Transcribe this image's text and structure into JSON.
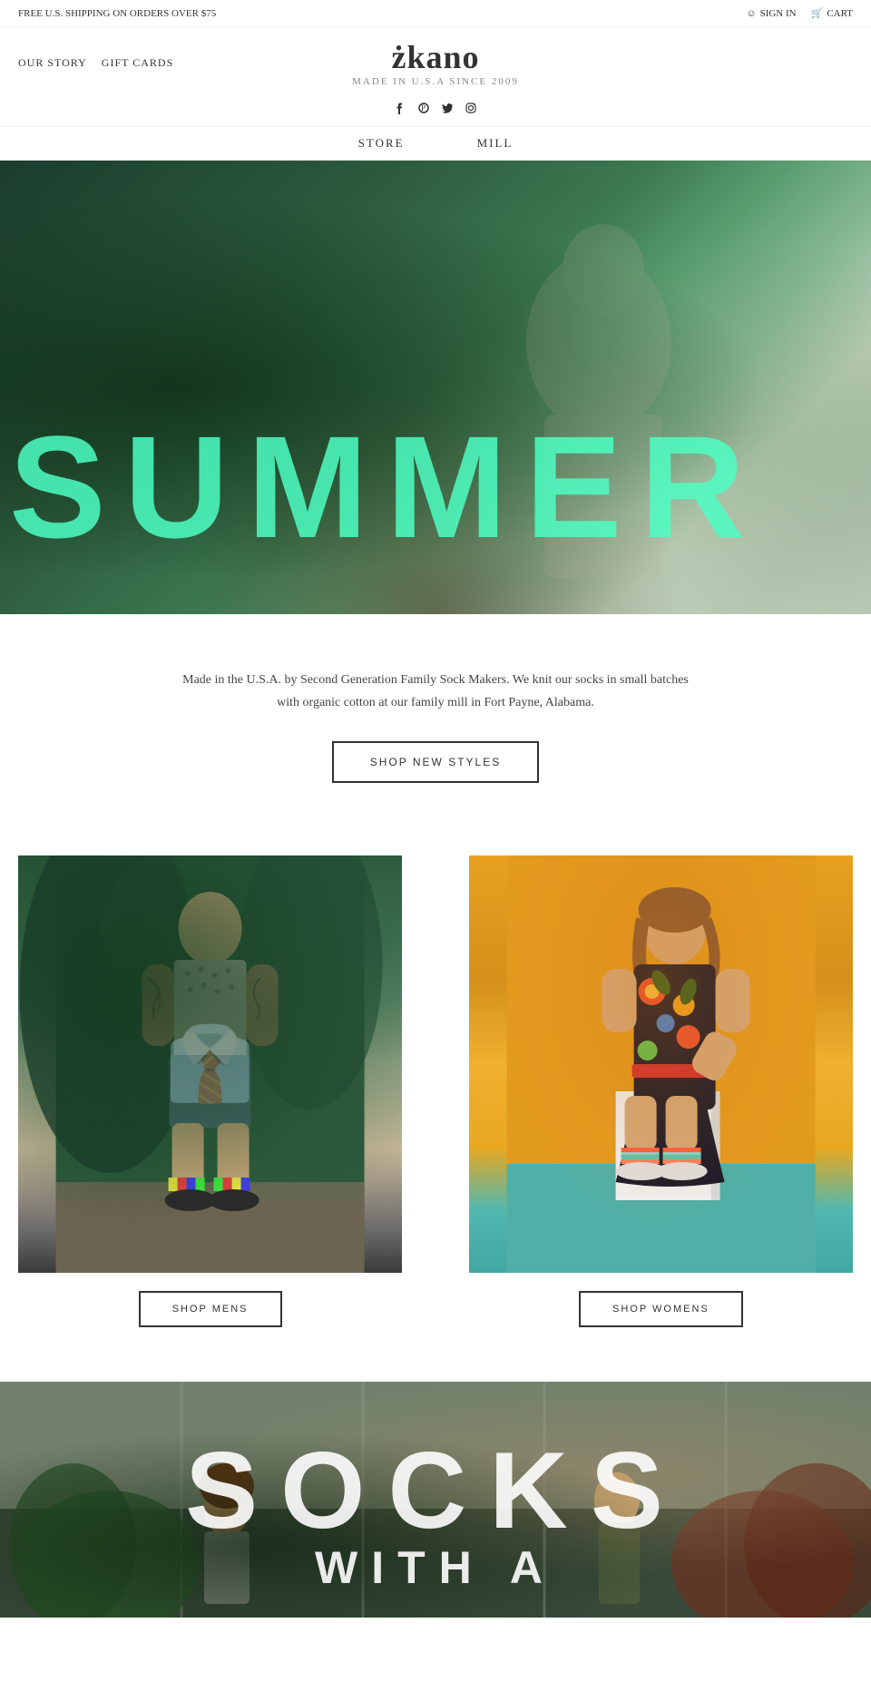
{
  "topbar": {
    "shipping_text": "FREE U.S. SHIPPING ON ORDERS OVER $75",
    "signin_label": "SIGN IN",
    "cart_label": "CART"
  },
  "header": {
    "logo": "zkano",
    "logo_dot_color": "#e8722a",
    "tagline": "Made in U.S.A Since 2009",
    "nav_left": [
      {
        "label": "OUR STORY",
        "href": "#"
      },
      {
        "label": "GIFT CARDS",
        "href": "#"
      }
    ],
    "nav_main": [
      {
        "label": "STORE",
        "href": "#"
      },
      {
        "label": "MILL",
        "href": "#"
      }
    ],
    "social": [
      {
        "name": "facebook",
        "icon": "f",
        "href": "#"
      },
      {
        "name": "pinterest",
        "icon": "p",
        "href": "#"
      },
      {
        "name": "twitter",
        "icon": "t",
        "href": "#"
      },
      {
        "name": "instagram",
        "icon": "i",
        "href": "#"
      }
    ]
  },
  "hero": {
    "text": "SUMMER",
    "text_color": "#4dffc3"
  },
  "info": {
    "description": "Made in the U.S.A. by Second Generation Family Sock Makers. We knit our socks in small batches with organic cotton at our family mill in Fort Payne, Alabama.",
    "button_label": "SHOP NEW STYLES"
  },
  "products": [
    {
      "id": "mens",
      "button_label": "SHOP MENS"
    },
    {
      "id": "womens",
      "button_label": "SHOP WOMENS"
    }
  ],
  "bottom_banner": {
    "line1": "SOCKS",
    "line2": "WITH A"
  }
}
